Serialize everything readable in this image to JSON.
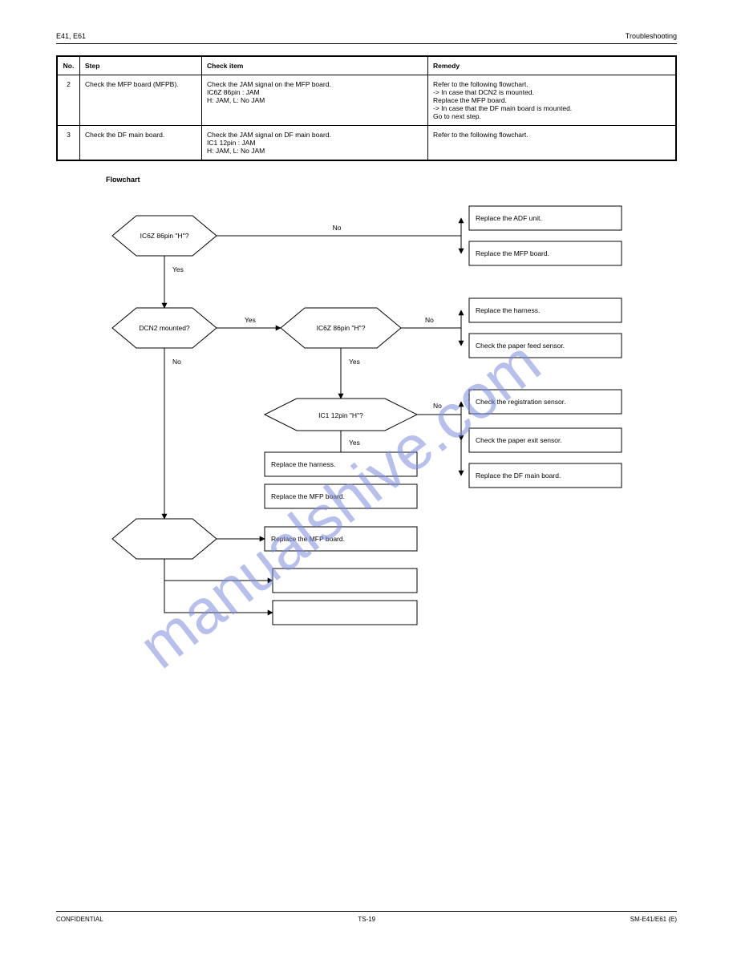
{
  "header": {
    "left": "E41, E61",
    "right": "Troubleshooting"
  },
  "table": {
    "head": {
      "no": "No.",
      "step": "Step",
      "check": "Check item",
      "remedy": "Remedy"
    },
    "rows": [
      {
        "no": "2",
        "step": "Check the MFP board (MFPB).",
        "check_lines": [
          "Check the JAM signal on the MFP board.",
          "IC6Z 86pin : JAM",
          "H: JAM, L: No JAM"
        ],
        "remedy_lines": [
          "Refer to the following flowchart.",
          "-> In case that DCN2 is mounted.",
          " Replace the MFP board.",
          "-> In case that the DF main board is mounted.",
          " Go to next step."
        ]
      },
      {
        "no": "3",
        "step": "Check the DF main board.",
        "check_lines": [
          "Check the JAM signal on DF main board.",
          "IC1 12pin : JAM",
          "H: JAM, L: No JAM"
        ],
        "remedy_lines": [
          "Refer to the following flowchart."
        ]
      }
    ]
  },
  "flow_title": "Flowchart",
  "flow": {
    "d1": {
      "text": "IC6Z 86pin \"H\"?",
      "no": "No",
      "yes": "Yes"
    },
    "d2": {
      "text": "DCN2 mounted?",
      "no": "No",
      "yes": "Yes"
    },
    "d3": {
      "text": "IC6Z 86pin \"H\"?",
      "no": "No",
      "yes": "Yes"
    },
    "d4": {
      "text": "IC1 12pin \"H\"?",
      "no": "No",
      "yes": "Yes"
    },
    "r1": "Replace the ADF unit.",
    "r2": "Replace the MFP board.",
    "r3": "Replace the harness.",
    "r4": "Check the paper feed sensor.",
    "r5": "Check the registration sensor.",
    "r6": "Check the paper exit sensor.",
    "r7": "Replace the DF main board.",
    "r8": "Replace the harness.",
    "r9": "Replace the MFP board.",
    "r10": "Replace the MFP board."
  },
  "footer": {
    "left": "CONFIDENTIAL",
    "page": "TS-19",
    "right": "SM-E41/E61 (E)"
  }
}
